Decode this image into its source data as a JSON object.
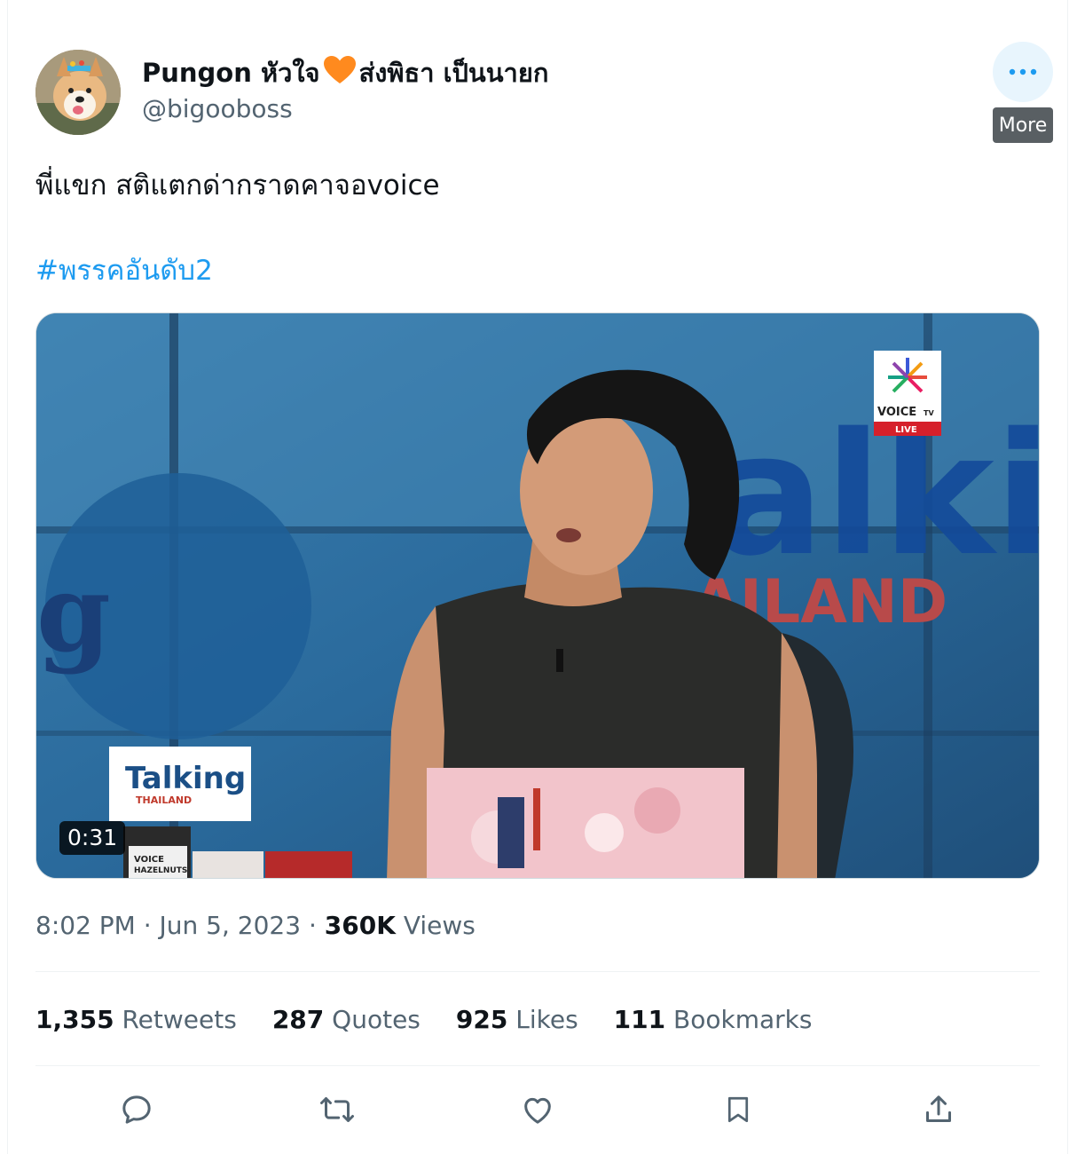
{
  "author": {
    "display_name_part1": "Pungon หัวใจ",
    "display_name_part2": "ส่งพิธา เป็นนายก",
    "handle": "@bigooboss"
  },
  "more_tooltip": "More",
  "tweet": {
    "text": "พี่แขก สติแตกด่ากราดคาจอvoice",
    "hashtag": "#พรรคอันดับ2"
  },
  "video": {
    "duration": "0:31",
    "overlay_brand": "Talking",
    "overlay_sub": "THAILAND",
    "channel": "VOICE",
    "channel_tv": "TV",
    "live": "LIVE",
    "bg_word_2": "AILAND"
  },
  "meta": {
    "time": "8:02 PM",
    "date": "Jun 5, 2023",
    "views_count": "360K",
    "views_label": "Views"
  },
  "stats": [
    {
      "count": "1,355",
      "label": "Retweets"
    },
    {
      "count": "287",
      "label": "Quotes"
    },
    {
      "count": "925",
      "label": "Likes"
    },
    {
      "count": "111",
      "label": "Bookmarks"
    }
  ],
  "colors": {
    "accent": "#1d9bf0",
    "secondary_text": "#536471",
    "heart": "#ff8a1e"
  },
  "icons": [
    "reply-icon",
    "retweet-icon",
    "like-icon",
    "bookmark-icon",
    "share-icon",
    "more-dots-icon"
  ]
}
